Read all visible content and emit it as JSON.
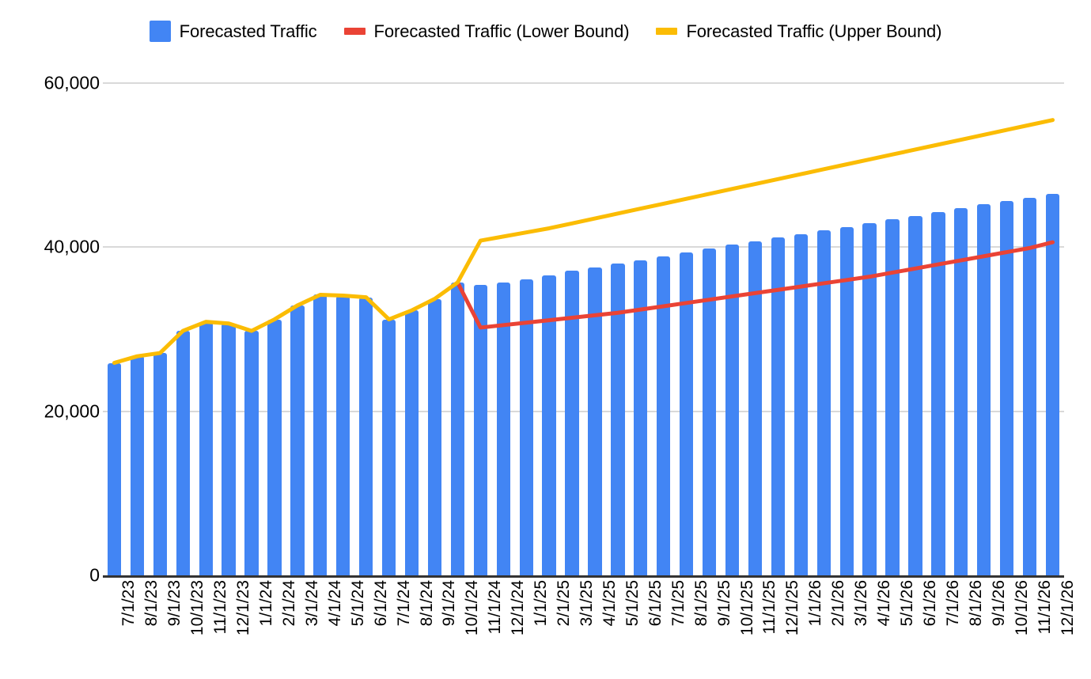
{
  "legend": {
    "position": "top-center",
    "items": [
      {
        "label": "Forecasted Traffic",
        "color": "#4285F4",
        "marker": "bar-swatch"
      },
      {
        "label": "Forecasted Traffic (Lower Bound)",
        "color": "#EA4335",
        "marker": "line-swatch"
      },
      {
        "label": "Forecasted Traffic (Upper Bound)",
        "color": "#FBBC04",
        "marker": "line-swatch"
      }
    ]
  },
  "axes": {
    "y_ticks": [
      "0",
      "20,000",
      "40,000",
      "60,000"
    ],
    "x_label": "",
    "y_label": ""
  },
  "chart_data": {
    "type": "bar",
    "title": "",
    "subtitle": "",
    "xlabel": "",
    "ylabel": "",
    "ylim": [
      0,
      60000
    ],
    "yticks": [
      0,
      20000,
      40000,
      60000
    ],
    "ytick_labels": [
      "0",
      "20,000",
      "40,000",
      "60,000"
    ],
    "grid": true,
    "legend_position": "top-center",
    "categories": [
      "7/1/23",
      "8/1/23",
      "9/1/23",
      "10/1/23",
      "11/1/23",
      "12/1/23",
      "1/1/24",
      "2/1/24",
      "3/1/24",
      "4/1/24",
      "5/1/24",
      "6/1/24",
      "7/1/24",
      "8/1/24",
      "9/1/24",
      "10/1/24",
      "11/1/24",
      "12/1/24",
      "1/1/25",
      "2/1/25",
      "3/1/25",
      "4/1/25",
      "5/1/25",
      "6/1/25",
      "7/1/25",
      "8/1/25",
      "9/1/25",
      "10/1/25",
      "11/1/25",
      "12/1/25",
      "1/1/26",
      "2/1/26",
      "3/1/26",
      "4/1/26",
      "5/1/26",
      "6/1/26",
      "7/1/26",
      "8/1/26",
      "9/1/26",
      "10/1/26",
      "11/1/26",
      "12/1/26"
    ],
    "series": [
      {
        "name": "Forecasted Traffic",
        "type": "bar",
        "color": "#4285F4",
        "values": [
          25900,
          26700,
          27100,
          29800,
          30900,
          30700,
          29800,
          31200,
          32900,
          34200,
          34100,
          33900,
          31200,
          32300,
          33700,
          35700,
          35400,
          35700,
          36100,
          36600,
          37100,
          37500,
          38000,
          38400,
          38900,
          39400,
          39800,
          40300,
          40700,
          41200,
          41600,
          42100,
          42400,
          42900,
          43400,
          43800,
          44300,
          44800,
          45200,
          45600,
          46000,
          46500
        ]
      },
      {
        "name": "Forecasted Traffic (Lower Bound)",
        "type": "line",
        "color": "#EA4335",
        "values": [
          null,
          null,
          null,
          null,
          null,
          null,
          null,
          null,
          null,
          null,
          null,
          null,
          null,
          null,
          null,
          35700,
          30200,
          30500,
          30800,
          31100,
          31400,
          31700,
          32000,
          32400,
          32800,
          33200,
          33600,
          34000,
          34400,
          34800,
          35200,
          35600,
          36000,
          36400,
          36900,
          37400,
          37900,
          38400,
          38900,
          39400,
          39900,
          40600
        ]
      },
      {
        "name": "Forecasted Traffic (Upper Bound)",
        "type": "line",
        "color": "#FBBC04",
        "values": [
          25900,
          26700,
          27100,
          29800,
          30900,
          30700,
          29800,
          31200,
          32900,
          34200,
          34100,
          33900,
          31200,
          32300,
          33700,
          35700,
          40800,
          41300,
          41800,
          42300,
          42900,
          43500,
          44100,
          44700,
          45300,
          45900,
          46500,
          47100,
          47700,
          48300,
          48900,
          49500,
          50100,
          50700,
          51300,
          51900,
          52500,
          53100,
          53700,
          54300,
          54900,
          55500
        ]
      }
    ]
  }
}
